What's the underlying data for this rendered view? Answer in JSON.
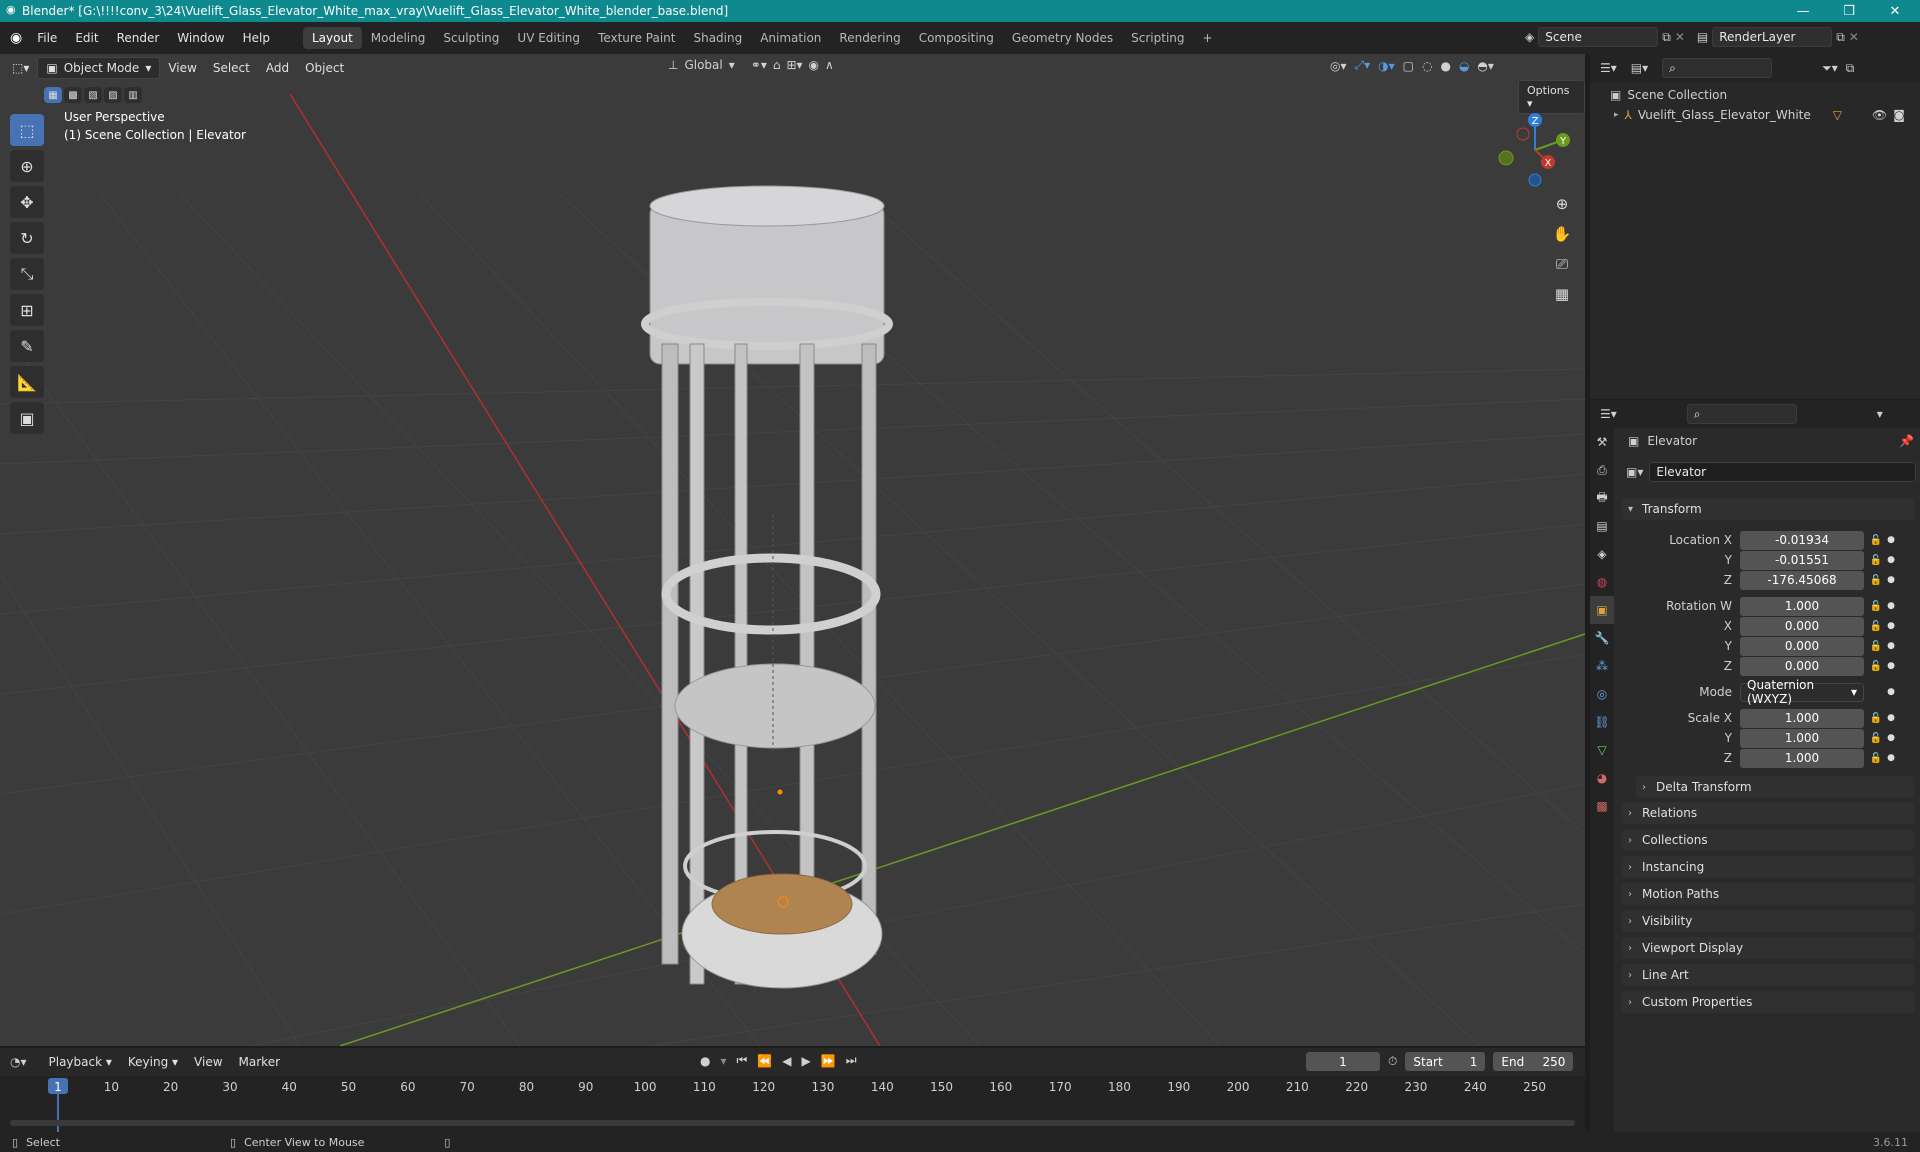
{
  "window": {
    "title": "Blender* [G:\\!!!!conv_3\\24\\Vuelift_Glass_Elevator_White_max_vray\\Vuelift_Glass_Elevator_White_blender_base.blend]"
  },
  "menus": [
    "File",
    "Edit",
    "Render",
    "Window",
    "Help"
  ],
  "workspaces": [
    "Layout",
    "Modeling",
    "Sculpting",
    "UV Editing",
    "Texture Paint",
    "Shading",
    "Animation",
    "Rendering",
    "Compositing",
    "Geometry Nodes",
    "Scripting",
    "+"
  ],
  "scene": {
    "name": "Scene",
    "render_layer": "RenderLayer"
  },
  "viewport": {
    "mode": "Object Mode",
    "menus": [
      "View",
      "Select",
      "Add",
      "Object"
    ],
    "transform_orientation": "Global",
    "options_label": "Options",
    "perspective": "User Perspective",
    "context": "(1) Scene Collection | Elevator",
    "gizmo_axes": {
      "z": "Z",
      "y": "Y",
      "x": "X"
    }
  },
  "outliner": {
    "root": "Scene Collection",
    "items": [
      {
        "label": "Vuelift_Glass_Elevator_White"
      }
    ]
  },
  "properties": {
    "object_name": "Elevator",
    "data_name": "Elevator",
    "transform_title": "Transform",
    "location": {
      "label_x": "Location X",
      "label_y": "Y",
      "label_z": "Z",
      "x": "-0.01934",
      "y": "-0.01551",
      "z": "-176.45068"
    },
    "rotation": {
      "label_w": "Rotation W",
      "label_x": "X",
      "label_y": "Y",
      "label_z": "Z",
      "w": "1.000",
      "x": "0.000",
      "y": "0.000",
      "z": "0.000"
    },
    "mode": {
      "label": "Mode",
      "value": "Quaternion (WXYZ)"
    },
    "scale": {
      "label_x": "Scale X",
      "label_y": "Y",
      "label_z": "Z",
      "x": "1.000",
      "y": "1.000",
      "z": "1.000"
    },
    "delta_transform": "Delta Transform",
    "panels": [
      "Relations",
      "Collections",
      "Instancing",
      "Motion Paths",
      "Visibility",
      "Viewport Display",
      "Line Art",
      "Custom Properties"
    ]
  },
  "timeline": {
    "menus": [
      "Playback",
      "Keying",
      "View",
      "Marker"
    ],
    "current_frame": "1",
    "start_label": "Start",
    "start": "1",
    "end_label": "End",
    "end": "250",
    "frame_marks": [
      "1",
      "10",
      "20",
      "30",
      "40",
      "50",
      "60",
      "70",
      "80",
      "90",
      "100",
      "110",
      "120",
      "130",
      "140",
      "150",
      "160",
      "170",
      "180",
      "190",
      "200",
      "210",
      "220",
      "230",
      "240",
      "250"
    ]
  },
  "statusbar": {
    "select": "Select",
    "center": "Center View to Mouse",
    "version": "3.6.11"
  },
  "colors": {
    "accent": "#4772b3",
    "titlebar": "#0e8a8f",
    "x_axis": "#c0392b",
    "y_axis": "#6a9a1f",
    "z_axis": "#2f7fd8"
  }
}
